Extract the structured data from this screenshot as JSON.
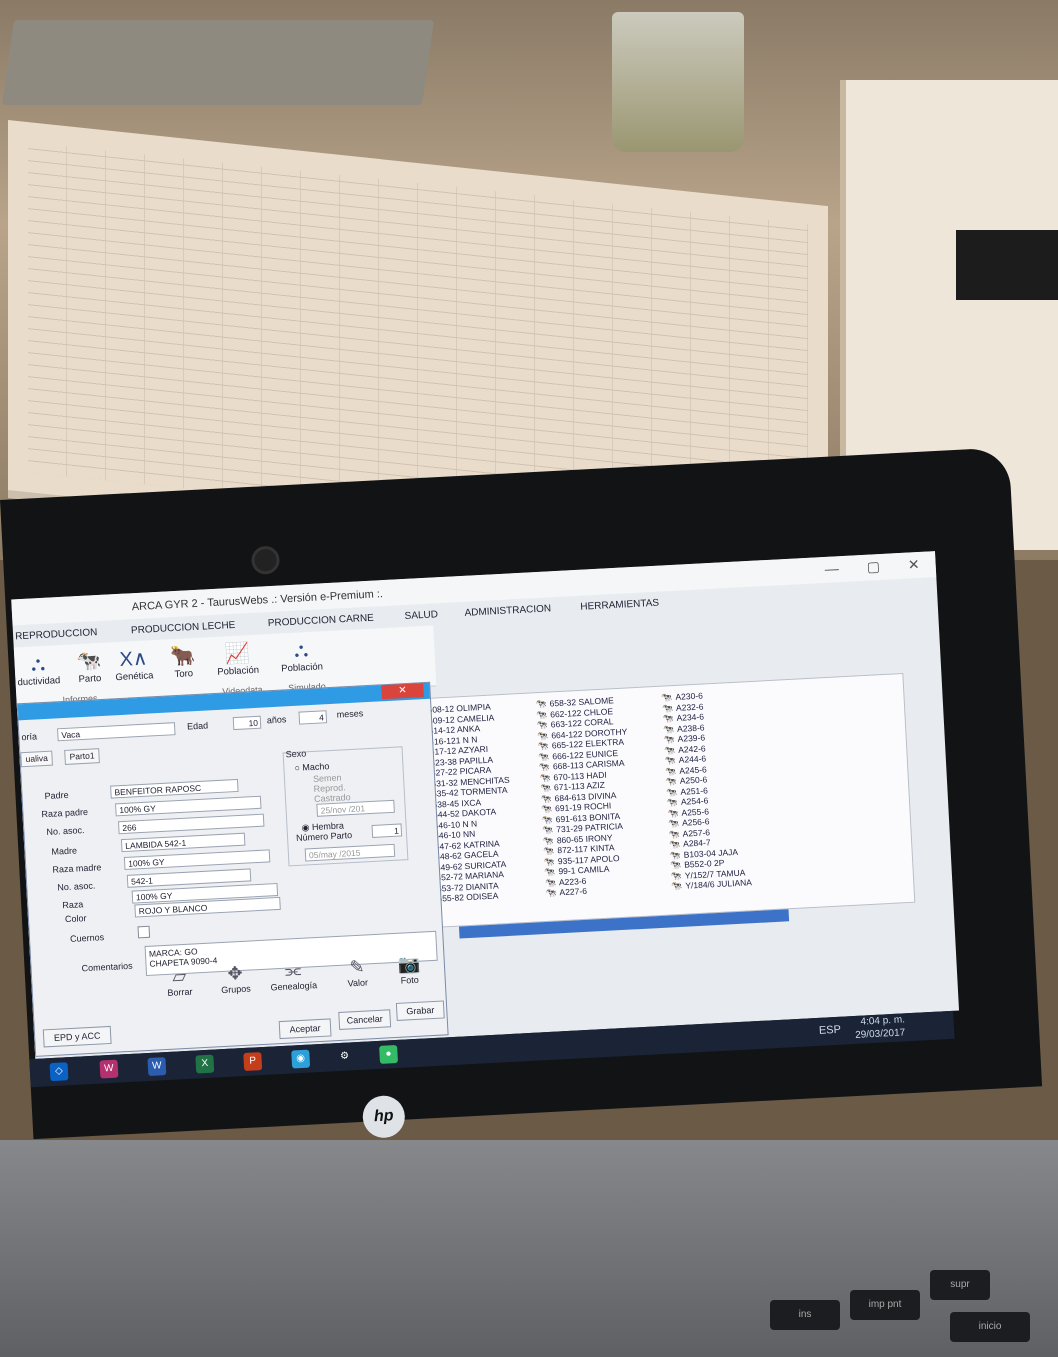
{
  "window": {
    "title": "ARCA GYR 2 - TaurusWebs .: Versión e-Premium :.",
    "controls": [
      "—",
      "▢",
      "✕"
    ]
  },
  "menu": [
    "REPRODUCCION",
    "PRODUCCION LECHE",
    "PRODUCCION CARNE",
    "SALUD",
    "ADMINISTRACION",
    "HERRAMIENTAS"
  ],
  "ribbon": {
    "buttons": [
      {
        "label": "ductividad",
        "icon": "network-icon"
      },
      {
        "label": "Parto",
        "icon": "cow-icon"
      },
      {
        "label": "Genética",
        "icon": "genetics-icon"
      },
      {
        "label": "Toro",
        "icon": "bull-icon"
      },
      {
        "label": "Población",
        "icon": "chart-icon"
      },
      {
        "label": "Población",
        "icon": "network-icon"
      }
    ],
    "groups": [
      "Informes",
      "Videodata",
      "Simulado"
    ]
  },
  "dialog": {
    "categoria_label": "oría",
    "categoria_value": "Vaca",
    "edad_label": "Edad",
    "edad_anos": "10",
    "anos_label": "años",
    "edad_meses": "4",
    "meses_label": "meses",
    "tabs": [
      "ualiva",
      "Parto1"
    ],
    "padre_label": "Padre",
    "padre_value": "BENFEITOR RAPOSC",
    "raza_padre_label": "Raza padre",
    "raza_padre_value": "100% GY",
    "no_asoc_label": "No. asoc.",
    "no_asoc_padre": "266",
    "madre_label": "Madre",
    "madre_value": "LAMBIDA 542-1",
    "raza_madre_label": "Raza madre",
    "raza_madre_value": "100% GY",
    "no_asoc_madre": "542-1",
    "raza_label": "Raza",
    "raza_value": "100% GY",
    "color_label": "Color",
    "color_value": "ROJO Y BLANCO",
    "cuernos_label": "Cuernos",
    "sexo_label": "Sexo",
    "macho_label": "Macho",
    "semen_label": "Semen",
    "reprod_label": "Reprod.",
    "castrado_label": "Castrado",
    "castrado_date": "25/nov /201",
    "hembra_label": "Hembra",
    "numero_parto_label": "Número Parto",
    "numero_parto_value": "1",
    "parto_date": "05/may /2015",
    "comentarios_label": "Comentarios",
    "comentarios_value_1": "MARCA: GO",
    "comentarios_value_2": "CHAPETA 9090-4",
    "tools": [
      "Borrar",
      "Grupos",
      "Genealogía",
      "Valor",
      "Foto"
    ],
    "epd_label": "EPD y ACC",
    "aceptar": "Aceptar",
    "cancelar": "Cancelar",
    "grabar": "Grabar"
  },
  "animals": {
    "col1": [
      "608-12 OLIMPIA",
      "609-12 CAMELIA",
      "614-12 ANKA",
      "616-121 N N",
      "617-12 AZYARI",
      "623-38 PAPILLA",
      "627-22 PICARA",
      "631-32 MENCHITAS",
      "635-42 TORMENTA",
      "638-45 IXCA",
      "644-52 DAKOTA",
      "646-10 N N",
      "646-10 NN",
      "647-62 KATRINA",
      "648-62 GACELA",
      "649-62 SURICATA",
      "652-72 MARIANA",
      "653-72 DIANITA",
      "655-82 ODISEA"
    ],
    "col2": [
      "658-32 SALOME",
      "662-122 CHLOE",
      "663-122 CORAL",
      "664-122 DOROTHY",
      "665-122 ELEKTRA",
      "666-122 EUNICE",
      "668-113 CARISMA",
      "670-113 HADI",
      "671-113 AZIZ",
      "684-613 DIVINA",
      "691-19 ROCHI",
      "691-613 BONITA",
      "731-29 PATRICIA",
      "860-65 IRONY",
      "872-117 KINTA",
      "935-117 APOLO",
      "99-1 CAMILA",
      "A223-6",
      "A227-6"
    ],
    "col3": [
      "A230-6",
      "A232-6",
      "A234-6",
      "A238-6",
      "A239-6",
      "A242-6",
      "A244-6",
      "A245-6",
      "A250-6",
      "A251-6",
      "A254-6",
      "A255-6",
      "A256-6",
      "A257-6",
      "A284-7",
      "B103-04 JAJA",
      "B552-0 2P",
      "Y/152/7 TAMUA",
      "Y/184/6 JULIANA"
    ]
  },
  "taskbar": {
    "language": "ESP",
    "time": "4:04 p. m.",
    "date": "29/03/2017"
  },
  "brand": "hp",
  "keys": [
    "supr",
    "imp pnt",
    "ins",
    "inicio"
  ]
}
